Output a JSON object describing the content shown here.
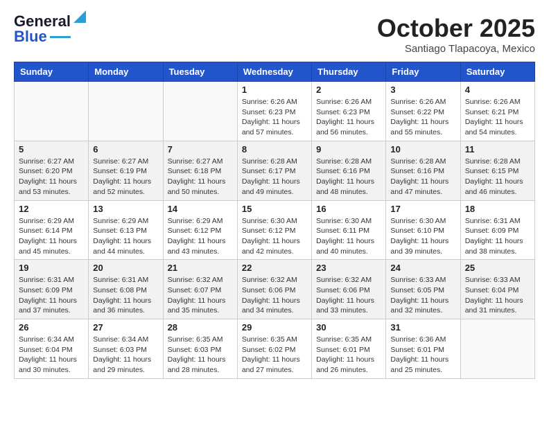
{
  "header": {
    "logo_general": "General",
    "logo_blue": "Blue",
    "month": "October 2025",
    "location": "Santiago Tlapacoya, Mexico"
  },
  "days_of_week": [
    "Sunday",
    "Monday",
    "Tuesday",
    "Wednesday",
    "Thursday",
    "Friday",
    "Saturday"
  ],
  "weeks": [
    [
      {
        "day": "",
        "info": ""
      },
      {
        "day": "",
        "info": ""
      },
      {
        "day": "",
        "info": ""
      },
      {
        "day": "1",
        "info": "Sunrise: 6:26 AM\nSunset: 6:23 PM\nDaylight: 11 hours and 57 minutes."
      },
      {
        "day": "2",
        "info": "Sunrise: 6:26 AM\nSunset: 6:23 PM\nDaylight: 11 hours and 56 minutes."
      },
      {
        "day": "3",
        "info": "Sunrise: 6:26 AM\nSunset: 6:22 PM\nDaylight: 11 hours and 55 minutes."
      },
      {
        "day": "4",
        "info": "Sunrise: 6:26 AM\nSunset: 6:21 PM\nDaylight: 11 hours and 54 minutes."
      }
    ],
    [
      {
        "day": "5",
        "info": "Sunrise: 6:27 AM\nSunset: 6:20 PM\nDaylight: 11 hours and 53 minutes."
      },
      {
        "day": "6",
        "info": "Sunrise: 6:27 AM\nSunset: 6:19 PM\nDaylight: 11 hours and 52 minutes."
      },
      {
        "day": "7",
        "info": "Sunrise: 6:27 AM\nSunset: 6:18 PM\nDaylight: 11 hours and 50 minutes."
      },
      {
        "day": "8",
        "info": "Sunrise: 6:28 AM\nSunset: 6:17 PM\nDaylight: 11 hours and 49 minutes."
      },
      {
        "day": "9",
        "info": "Sunrise: 6:28 AM\nSunset: 6:16 PM\nDaylight: 11 hours and 48 minutes."
      },
      {
        "day": "10",
        "info": "Sunrise: 6:28 AM\nSunset: 6:16 PM\nDaylight: 11 hours and 47 minutes."
      },
      {
        "day": "11",
        "info": "Sunrise: 6:28 AM\nSunset: 6:15 PM\nDaylight: 11 hours and 46 minutes."
      }
    ],
    [
      {
        "day": "12",
        "info": "Sunrise: 6:29 AM\nSunset: 6:14 PM\nDaylight: 11 hours and 45 minutes."
      },
      {
        "day": "13",
        "info": "Sunrise: 6:29 AM\nSunset: 6:13 PM\nDaylight: 11 hours and 44 minutes."
      },
      {
        "day": "14",
        "info": "Sunrise: 6:29 AM\nSunset: 6:12 PM\nDaylight: 11 hours and 43 minutes."
      },
      {
        "day": "15",
        "info": "Sunrise: 6:30 AM\nSunset: 6:12 PM\nDaylight: 11 hours and 42 minutes."
      },
      {
        "day": "16",
        "info": "Sunrise: 6:30 AM\nSunset: 6:11 PM\nDaylight: 11 hours and 40 minutes."
      },
      {
        "day": "17",
        "info": "Sunrise: 6:30 AM\nSunset: 6:10 PM\nDaylight: 11 hours and 39 minutes."
      },
      {
        "day": "18",
        "info": "Sunrise: 6:31 AM\nSunset: 6:09 PM\nDaylight: 11 hours and 38 minutes."
      }
    ],
    [
      {
        "day": "19",
        "info": "Sunrise: 6:31 AM\nSunset: 6:09 PM\nDaylight: 11 hours and 37 minutes."
      },
      {
        "day": "20",
        "info": "Sunrise: 6:31 AM\nSunset: 6:08 PM\nDaylight: 11 hours and 36 minutes."
      },
      {
        "day": "21",
        "info": "Sunrise: 6:32 AM\nSunset: 6:07 PM\nDaylight: 11 hours and 35 minutes."
      },
      {
        "day": "22",
        "info": "Sunrise: 6:32 AM\nSunset: 6:06 PM\nDaylight: 11 hours and 34 minutes."
      },
      {
        "day": "23",
        "info": "Sunrise: 6:32 AM\nSunset: 6:06 PM\nDaylight: 11 hours and 33 minutes."
      },
      {
        "day": "24",
        "info": "Sunrise: 6:33 AM\nSunset: 6:05 PM\nDaylight: 11 hours and 32 minutes."
      },
      {
        "day": "25",
        "info": "Sunrise: 6:33 AM\nSunset: 6:04 PM\nDaylight: 11 hours and 31 minutes."
      }
    ],
    [
      {
        "day": "26",
        "info": "Sunrise: 6:34 AM\nSunset: 6:04 PM\nDaylight: 11 hours and 30 minutes."
      },
      {
        "day": "27",
        "info": "Sunrise: 6:34 AM\nSunset: 6:03 PM\nDaylight: 11 hours and 29 minutes."
      },
      {
        "day": "28",
        "info": "Sunrise: 6:35 AM\nSunset: 6:03 PM\nDaylight: 11 hours and 28 minutes."
      },
      {
        "day": "29",
        "info": "Sunrise: 6:35 AM\nSunset: 6:02 PM\nDaylight: 11 hours and 27 minutes."
      },
      {
        "day": "30",
        "info": "Sunrise: 6:35 AM\nSunset: 6:01 PM\nDaylight: 11 hours and 26 minutes."
      },
      {
        "day": "31",
        "info": "Sunrise: 6:36 AM\nSunset: 6:01 PM\nDaylight: 11 hours and 25 minutes."
      },
      {
        "day": "",
        "info": ""
      }
    ]
  ]
}
